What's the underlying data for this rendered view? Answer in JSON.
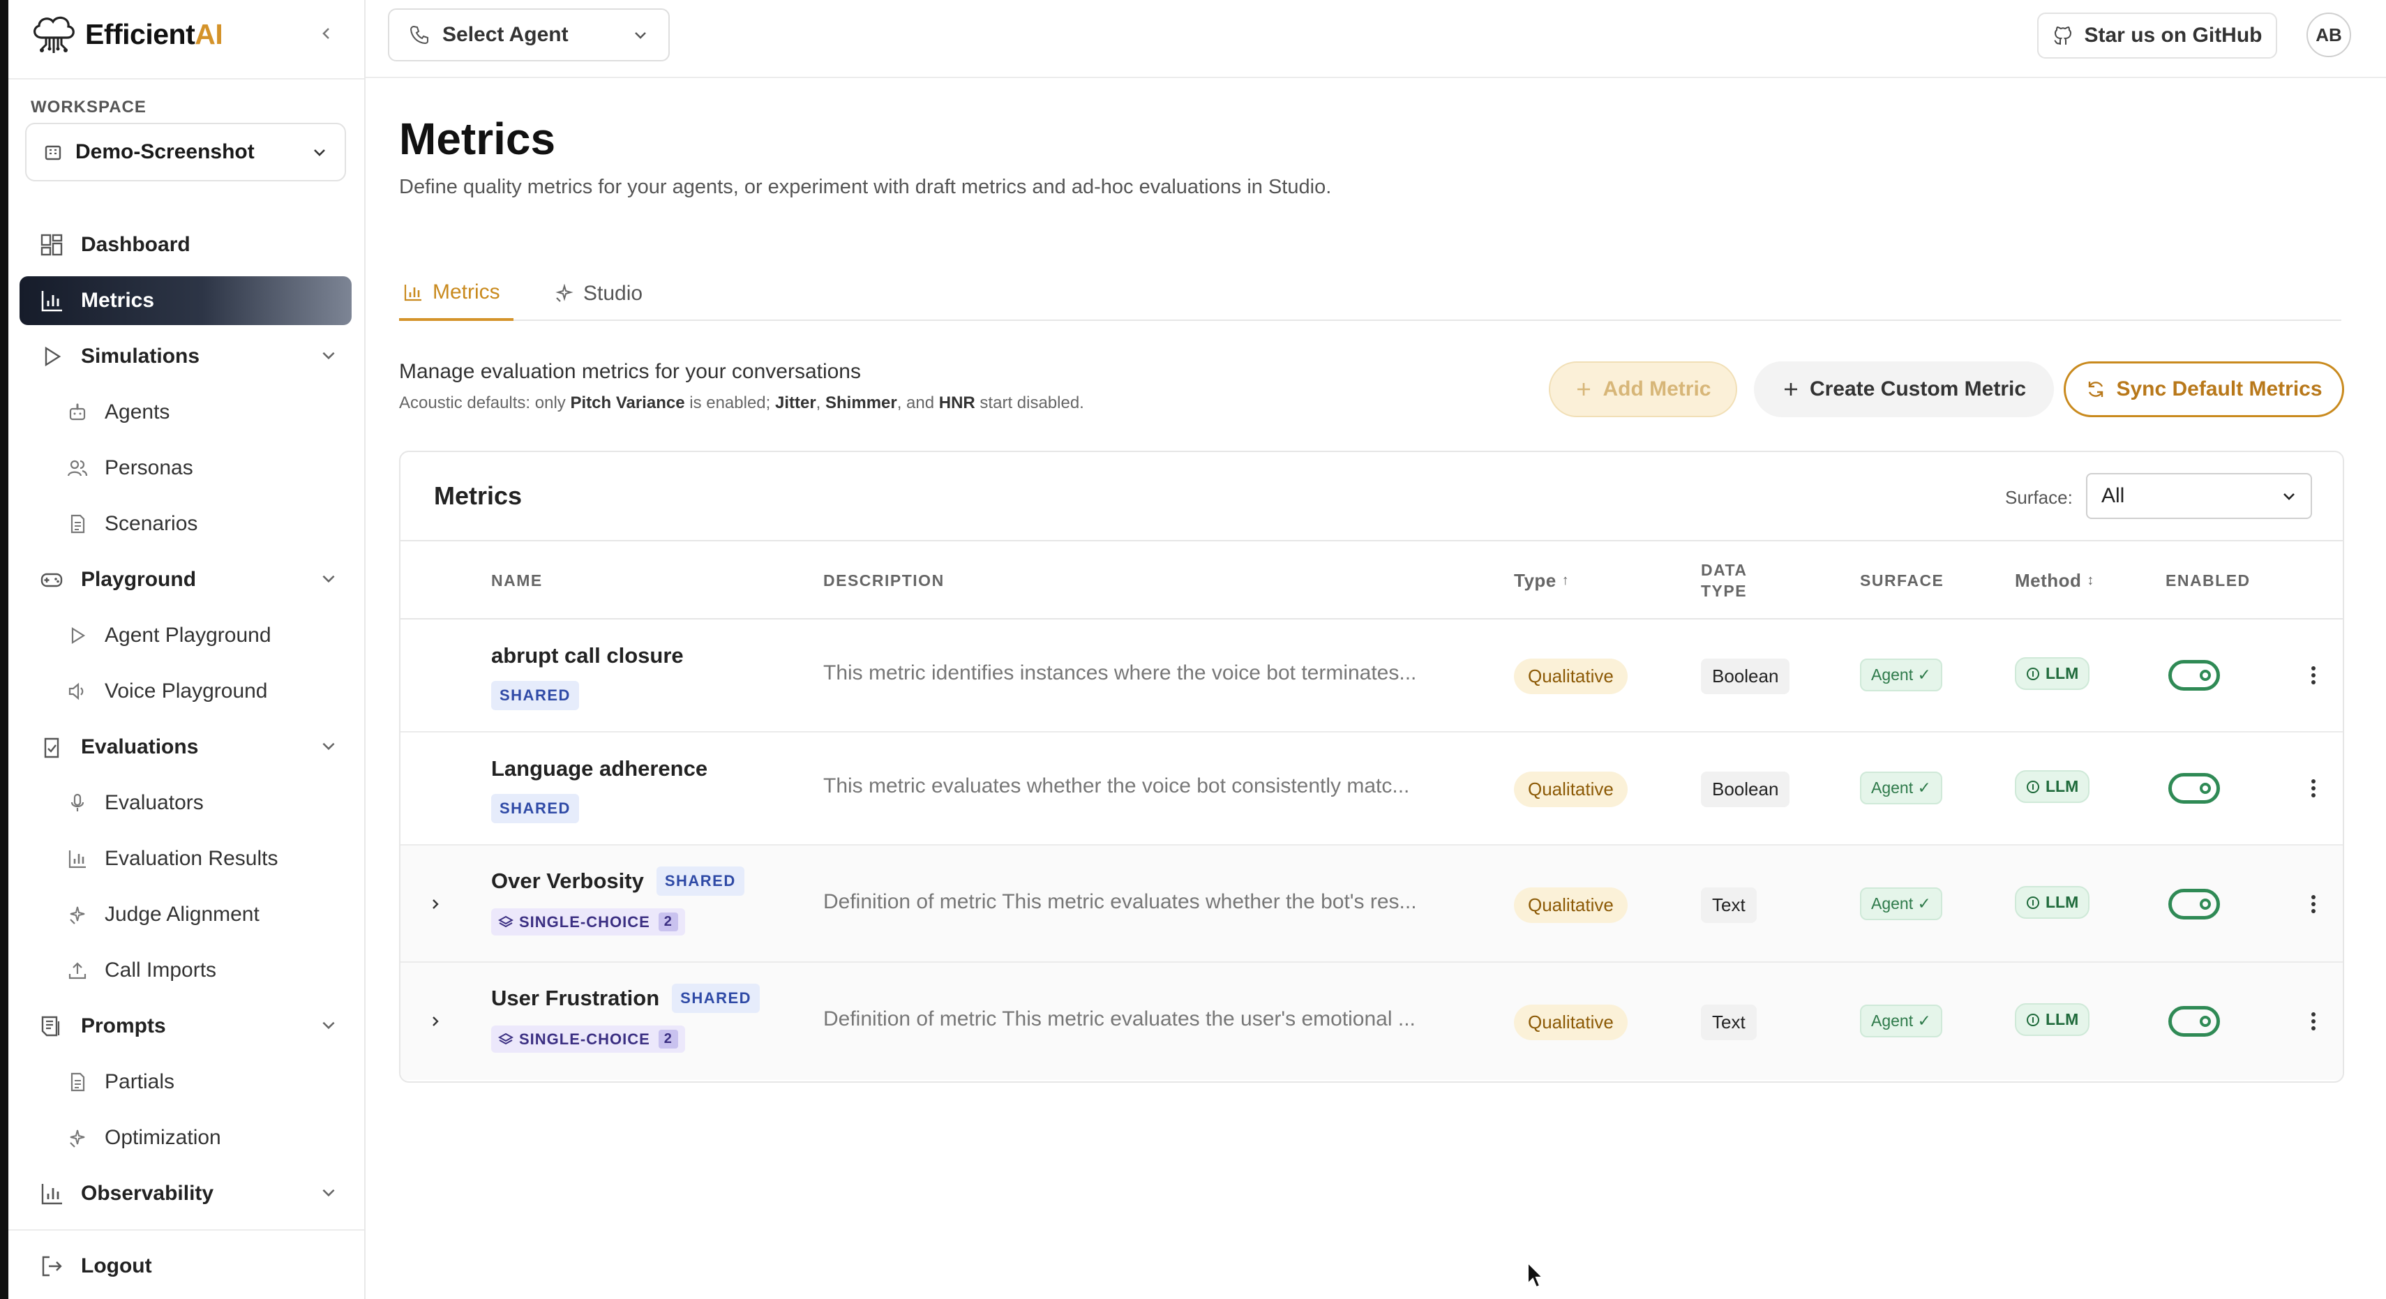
{
  "brand": {
    "name_prefix": "Efficient",
    "name_suffix": "AI"
  },
  "sidebar": {
    "workspace_label": "WORKSPACE",
    "workspace_value": "Demo-Screenshot",
    "items": [
      {
        "label": "Dashboard"
      },
      {
        "label": "Metrics"
      },
      {
        "label": "Simulations"
      },
      {
        "label": "Agents"
      },
      {
        "label": "Personas"
      },
      {
        "label": "Scenarios"
      },
      {
        "label": "Playground"
      },
      {
        "label": "Agent Playground"
      },
      {
        "label": "Voice Playground"
      },
      {
        "label": "Evaluations"
      },
      {
        "label": "Evaluators"
      },
      {
        "label": "Evaluation Results"
      },
      {
        "label": "Judge Alignment"
      },
      {
        "label": "Call Imports"
      },
      {
        "label": "Prompts"
      },
      {
        "label": "Partials"
      },
      {
        "label": "Optimization"
      },
      {
        "label": "Observability"
      }
    ],
    "logout_label": "Logout"
  },
  "topbar": {
    "agent_select": "Select Agent",
    "github_label": "Star us on GitHub",
    "avatar_initials": "AB"
  },
  "page": {
    "title": "Metrics",
    "description": "Define quality metrics for your agents, or experiment with draft metrics and ad-hoc evaluations in Studio.",
    "tabs": [
      {
        "label": "Metrics"
      },
      {
        "label": "Studio"
      }
    ],
    "manage_title": "Manage evaluation metrics for your conversations",
    "manage_sub": {
      "prefix": "Acoustic defaults: only ",
      "pitch": "Pitch Variance",
      "mid": " is enabled; ",
      "jitter": "Jitter",
      "comma": ", ",
      "shimmer": "Shimmer",
      "and": ", and ",
      "hnr": "HNR",
      "suffix": " start disabled."
    },
    "buttons": {
      "add": "Add Metric",
      "custom": "Create Custom Metric",
      "sync": "Sync Default Metrics"
    }
  },
  "table": {
    "title": "Metrics",
    "surface_label": "Surface:",
    "surface_value": "All",
    "columns": {
      "name": "NAME",
      "description": "DESCRIPTION",
      "type": "Type",
      "data_type_1": "DATA",
      "data_type_2": "TYPE",
      "surface": "SURFACE",
      "method": "Method",
      "enabled": "ENABLED"
    },
    "rows": [
      {
        "name": "abrupt call closure",
        "badge": "SHARED",
        "description": "This metric identifies instances where the voice bot terminates...",
        "type": "Qualitative",
        "data_type": "Boolean",
        "surface": "Agent ✓",
        "method": "LLM",
        "enabled": true
      },
      {
        "name": "Language adherence",
        "badge": "SHARED",
        "description": "This metric evaluates whether the voice bot consistently matc...",
        "type": "Qualitative",
        "data_type": "Boolean",
        "surface": "Agent ✓",
        "method": "LLM",
        "enabled": true
      },
      {
        "name": "Over Verbosity",
        "badge": "SHARED",
        "choice": "SINGLE-CHOICE",
        "choice_count": "2",
        "description": "Definition of metric This metric evaluates whether the bot's res...",
        "type": "Qualitative",
        "data_type": "Text",
        "surface": "Agent ✓",
        "method": "LLM",
        "enabled": true
      },
      {
        "name": "User Frustration",
        "badge": "SHARED",
        "choice": "SINGLE-CHOICE",
        "choice_count": "2",
        "description": "Definition of metric This metric evaluates the user's emotional ...",
        "type": "Qualitative",
        "data_type": "Text",
        "surface": "Agent ✓",
        "method": "LLM",
        "enabled": true
      }
    ]
  },
  "colors": {
    "accent": "#d4932a",
    "active_nav": "#161c2a",
    "enabled_green": "#2f8a55"
  }
}
